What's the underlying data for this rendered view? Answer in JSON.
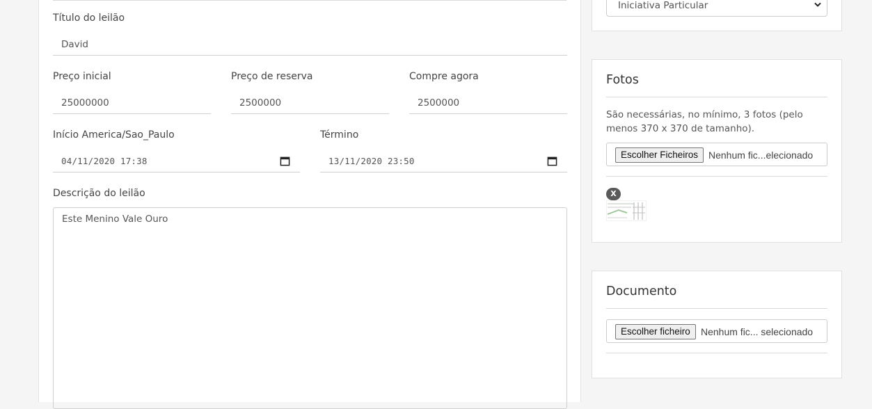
{
  "form": {
    "title_label": "Título do leilão",
    "title_value": "David",
    "start_price_label": "Preço inicial",
    "start_price_value": "25000000",
    "reserve_price_label": "Preço de reserva",
    "reserve_price_value": "2500000",
    "buy_now_label": "Compre agora",
    "buy_now_value": "2500000",
    "start_label": "Início America/Sao_Paulo",
    "start_value": "04/11/2020 17:38",
    "end_label": "Término",
    "end_value": "13/11/2020 23:50",
    "description_label": "Descrição do leilão",
    "description_value": "Este Menino Vale Ouro"
  },
  "sidebar": {
    "select_value": "Iniciativa Particular",
    "photos": {
      "title": "Fotos",
      "note": "São necessárias, no mínimo, 3 fotos (pelo menos 370 x 370 de tamanho).",
      "button_label": "Escolher Ficheiros",
      "file_status": "Nenhum fic...elecionado",
      "remove_label": "X"
    },
    "document": {
      "title": "Documento",
      "button_label": "Escolher ficheiro",
      "file_status": "Nenhum fic... selecionado"
    }
  },
  "icons": {
    "calendar": "calendar-icon",
    "select_arrow": "chevron-down-icon",
    "remove": "close-icon"
  }
}
